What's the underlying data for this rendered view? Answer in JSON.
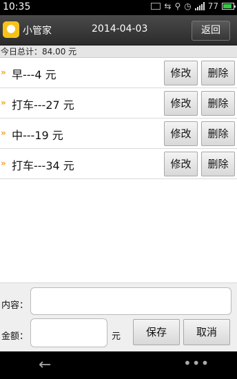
{
  "status_bar": {
    "time": "10:35",
    "battery": "77"
  },
  "header": {
    "app_title": "小管家",
    "date": "2014-04-03",
    "back_label": "返回"
  },
  "summary": {
    "total_text": "今日总计：84.00 元"
  },
  "expenses": [
    {
      "text": "早---4 元",
      "edit_label": "修改",
      "delete_label": "删除"
    },
    {
      "text": "打车---27 元",
      "edit_label": "修改",
      "delete_label": "删除"
    },
    {
      "text": "中---19 元",
      "edit_label": "修改",
      "delete_label": "删除"
    },
    {
      "text": "打车---34 元",
      "edit_label": "修改",
      "delete_label": "删除"
    }
  ],
  "form": {
    "content_label": "内容：",
    "content_value": "",
    "amount_label": "金额：",
    "amount_value": "",
    "unit_label": "元",
    "save_label": "保存",
    "cancel_label": "取消"
  },
  "icons": {
    "row_marker": "double-chevron-icon",
    "nav_back": "back-arrow-icon",
    "nav_menu": "more-dots-icon"
  },
  "colors": {
    "accent": "#f0a020",
    "logo": "#f5c21b",
    "header_bg": "#3a3a3a"
  }
}
